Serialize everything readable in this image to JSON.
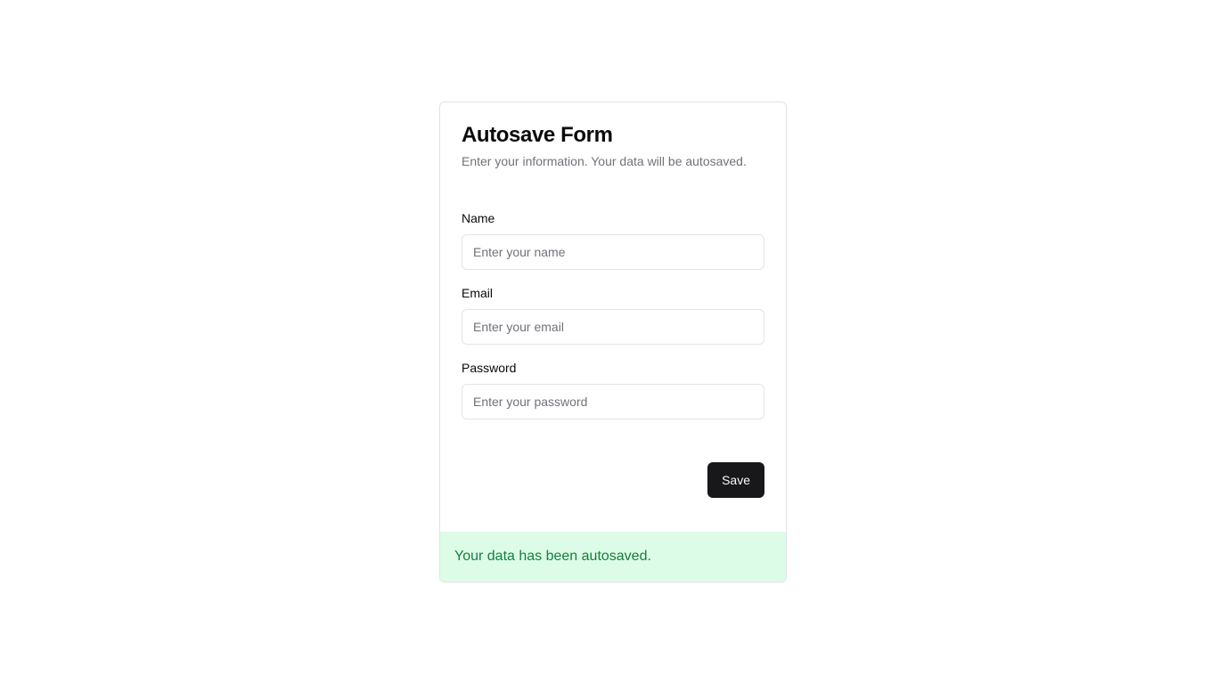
{
  "form": {
    "title": "Autosave Form",
    "description": "Enter your information. Your data will be autosaved.",
    "fields": [
      {
        "label": "Name",
        "placeholder": "Enter your name",
        "value": ""
      },
      {
        "label": "Email",
        "placeholder": "Enter your email",
        "value": ""
      },
      {
        "label": "Password",
        "placeholder": "Enter your password",
        "value": ""
      }
    ],
    "save_label": "Save",
    "status_message": "Your data has been autosaved."
  },
  "colors": {
    "button_bg": "#18181b",
    "status_bg": "#dcfce7",
    "status_text": "#15803d"
  }
}
